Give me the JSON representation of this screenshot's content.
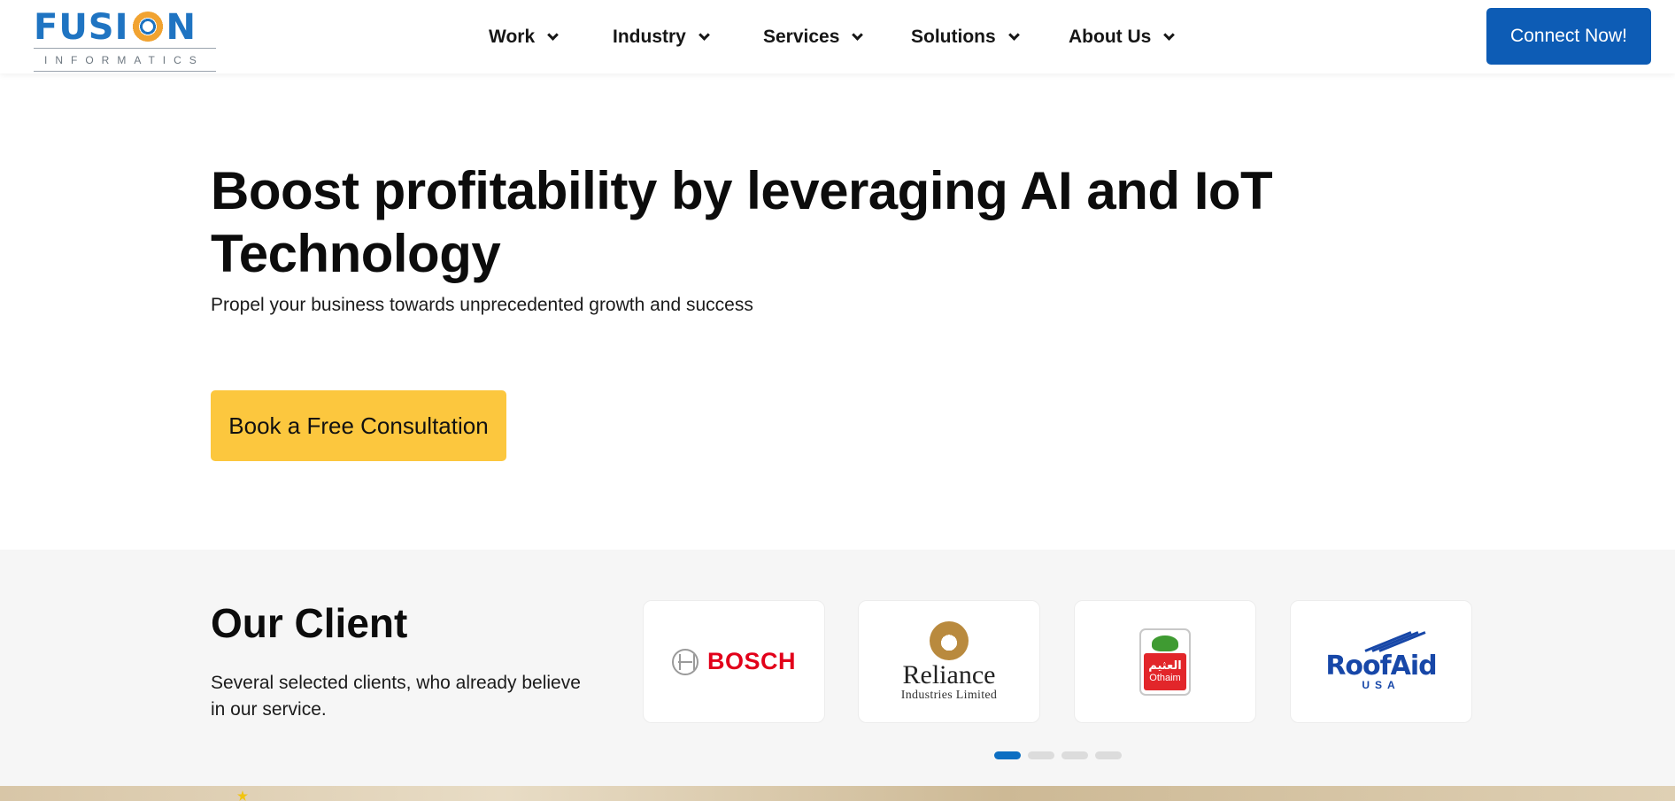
{
  "header": {
    "logo": {
      "name": "FUSION",
      "tagline": "INFORMATICS"
    },
    "nav": [
      {
        "label": "Work"
      },
      {
        "label": "Industry"
      },
      {
        "label": "Services"
      },
      {
        "label": "Solutions"
      },
      {
        "label": "About Us"
      }
    ],
    "cta_label": "Connect Now!",
    "colors": {
      "primary": "#0d5cb5",
      "logo_blue": "#1f74c2",
      "logo_orange": "#f1a331"
    }
  },
  "hero": {
    "title": "Boost profitability by leveraging AI and IoT Technology",
    "subtitle": "Propel your business towards unprecedented growth and success",
    "cta_label": "Book a Free Consultation",
    "cta_color": "#fcc73e"
  },
  "clients": {
    "title": "Our Client",
    "description": "Several selected clients, who already believe in our service.",
    "logos": [
      {
        "name": "BOSCH",
        "icon": "bosch-logo"
      },
      {
        "name": "Reliance",
        "subtitle": "Industries Limited",
        "icon": "reliance-logo"
      },
      {
        "name": "Othaim",
        "arabic": "العثيم",
        "icon": "othaim-logo"
      },
      {
        "name": "RoofAid",
        "subtitle": "USA",
        "icon": "roofaid-logo"
      }
    ],
    "carousel": {
      "pages": 4,
      "active_index": 0,
      "active_color": "#0d6fc2"
    }
  }
}
